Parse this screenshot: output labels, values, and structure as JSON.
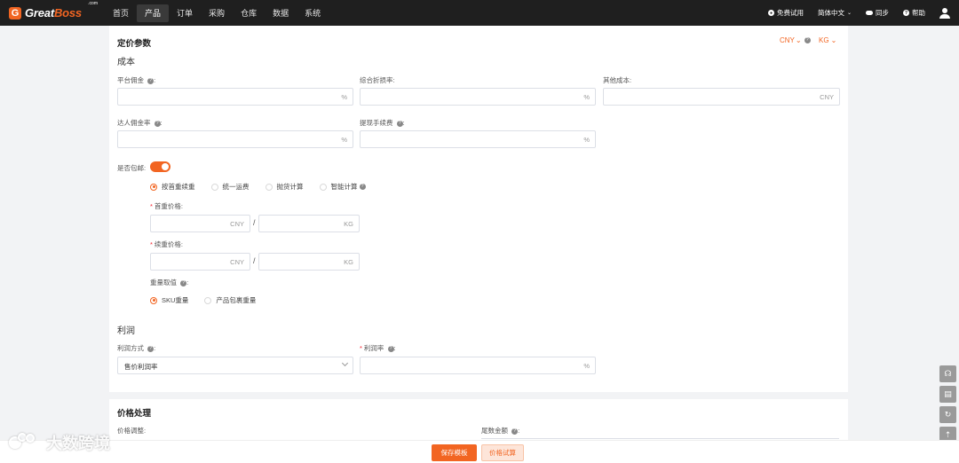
{
  "app": {
    "logo_main": "Great",
    "logo_accent": "Boss",
    "logo_com": ".com"
  },
  "nav": {
    "items": [
      "首页",
      "产品",
      "订单",
      "采购",
      "仓库",
      "数据",
      "系统"
    ],
    "active": "产品"
  },
  "top_right": {
    "trial": "免费试用",
    "language": "简体中文",
    "sync": "同步",
    "help": "帮助"
  },
  "pricing": {
    "title": "定价参数",
    "currency": "CNY",
    "weight_unit": "KG",
    "cost_section": "成本",
    "platform_commission_label": "平台佣金",
    "platform_commission_suffix": "%",
    "discount_rate_label": "综合折损率:",
    "discount_rate_suffix": "%",
    "other_cost_label": "其他成本:",
    "other_cost_suffix": "CNY",
    "influencer_rate_label": "达人佣金率",
    "influencer_rate_suffix": "%",
    "withdraw_fee_label": "提现手续费",
    "withdraw_fee_suffix": "%",
    "free_shipping_label": "是否包邮:",
    "shipping_methods": [
      "按首重续重",
      "统一运费",
      "抛货计算",
      "智能计算"
    ],
    "shipping_selected": "按首重续重",
    "first_weight_label": "首重价格:",
    "continued_weight_label": "续重价格:",
    "price_suffix": "CNY",
    "weight_suffix": "KG",
    "slash": "/",
    "weight_source_label": "重量取值",
    "weight_sources": [
      "SKU重量",
      "产品包裹重量"
    ],
    "weight_source_selected": "SKU重量",
    "profit_section": "利润",
    "profit_method_label": "利润方式",
    "profit_method_value": "售价利润率",
    "profit_rate_label": "利润率",
    "profit_rate_suffix": "%"
  },
  "price_processing": {
    "title": "价格处理",
    "adjust_label": "价格调整:",
    "tail_label": "尾数金额"
  },
  "footer": {
    "save_template": "保存模板",
    "price_trial": "价格试算"
  },
  "watermark": {
    "text": "大数跨境"
  },
  "side_tools": [
    "headset-icon",
    "document-icon",
    "refresh-icon",
    "back-to-top-icon"
  ],
  "colors": {
    "accent": "#f26522",
    "topbar": "#1f1f1f"
  }
}
